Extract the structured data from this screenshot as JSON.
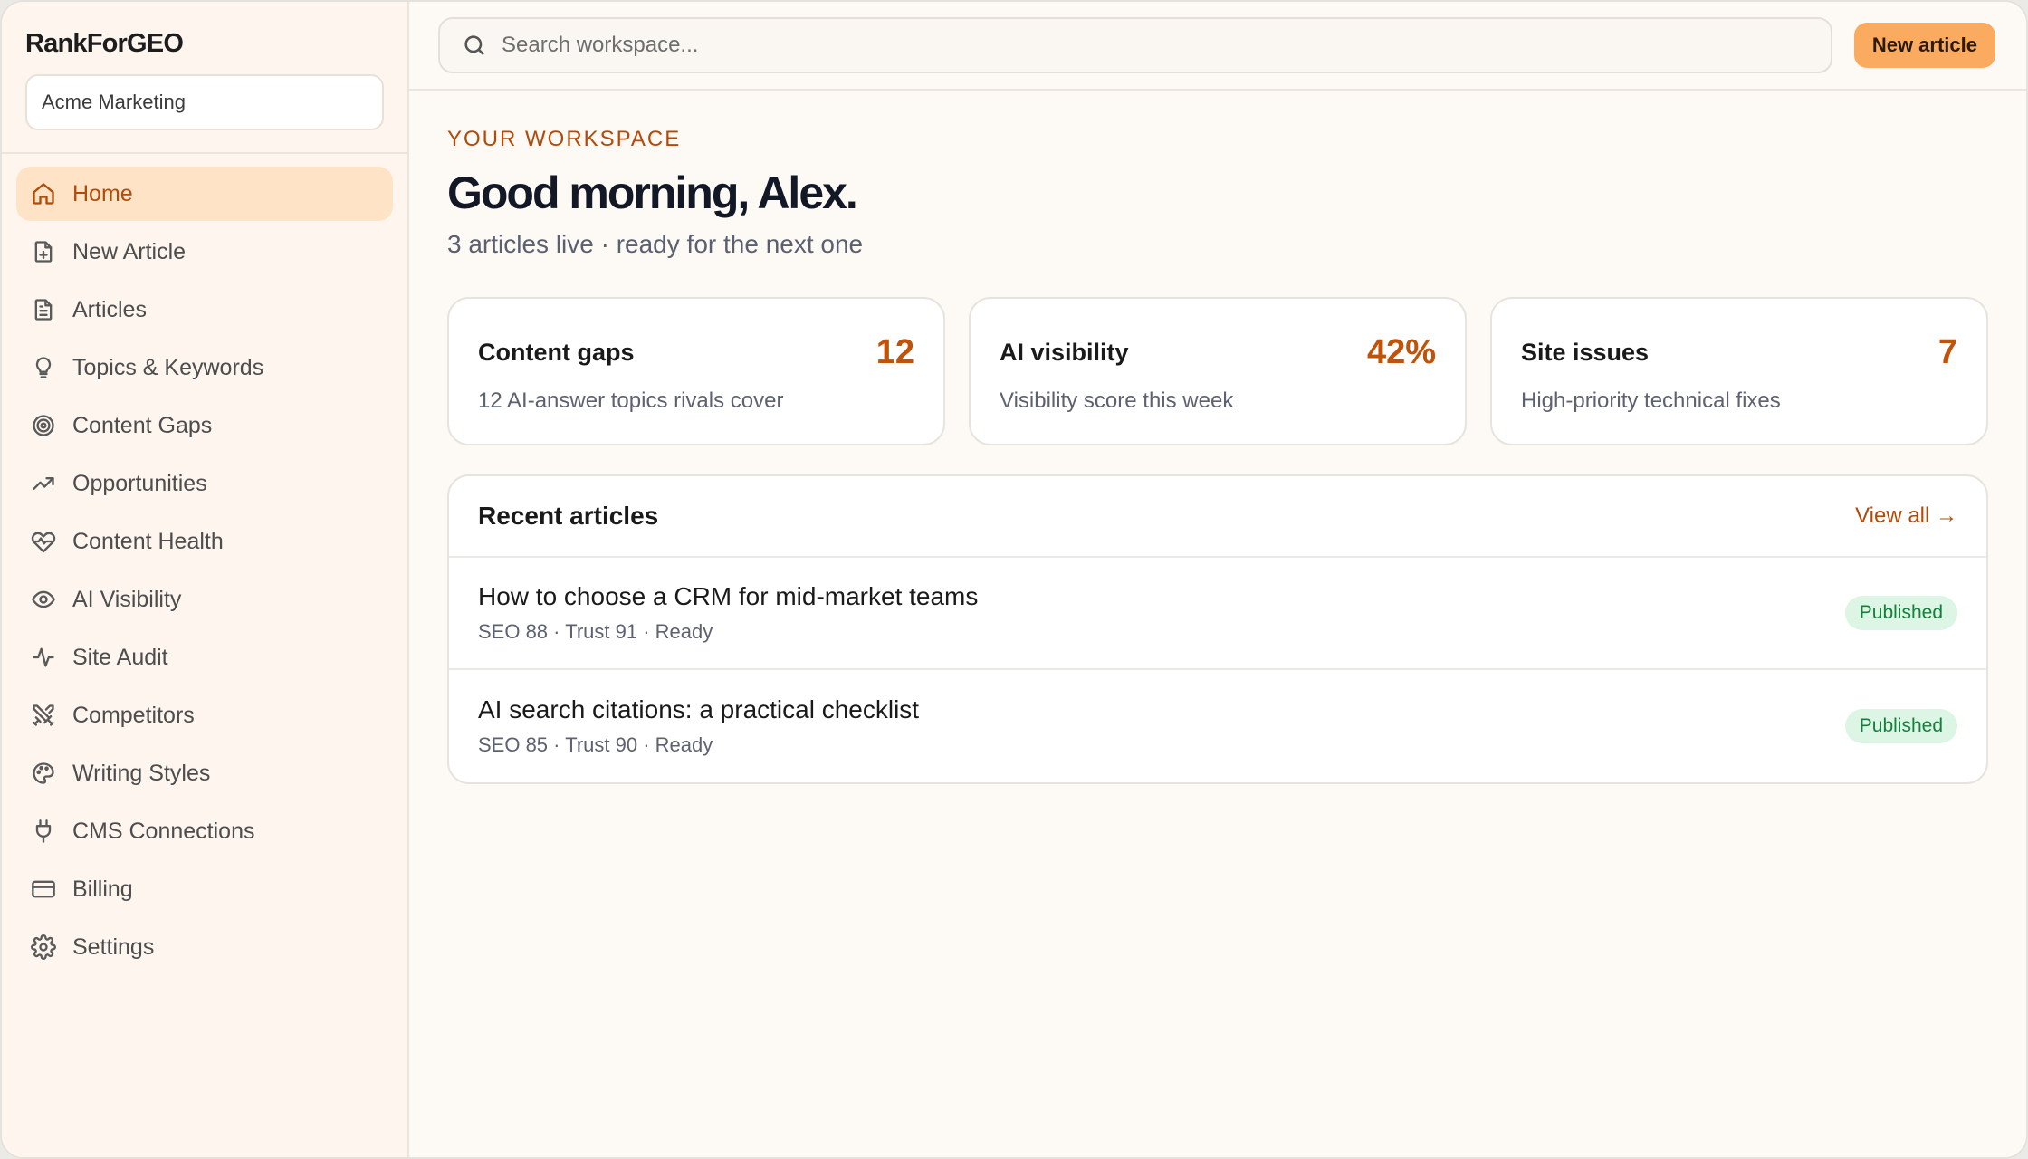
{
  "brand": "RankForGEO",
  "workspace": "Acme Marketing",
  "sidebar": {
    "items": [
      {
        "label": "Home",
        "icon": "home-icon",
        "active": true
      },
      {
        "label": "New Article",
        "icon": "file-plus-icon"
      },
      {
        "label": "Articles",
        "icon": "file-text-icon"
      },
      {
        "label": "Topics & Keywords",
        "icon": "lightbulb-icon"
      },
      {
        "label": "Content Gaps",
        "icon": "target-icon"
      },
      {
        "label": "Opportunities",
        "icon": "trending-up-icon"
      },
      {
        "label": "Content Health",
        "icon": "heart-pulse-icon"
      },
      {
        "label": "AI Visibility",
        "icon": "eye-icon"
      },
      {
        "label": "Site Audit",
        "icon": "activity-icon"
      },
      {
        "label": "Competitors",
        "icon": "swords-icon"
      },
      {
        "label": "Writing Styles",
        "icon": "palette-icon"
      },
      {
        "label": "CMS Connections",
        "icon": "plug-icon"
      },
      {
        "label": "Billing",
        "icon": "credit-card-icon"
      },
      {
        "label": "Settings",
        "icon": "gear-icon"
      }
    ]
  },
  "topbar": {
    "search_placeholder": "Search workspace...",
    "new_button": "New article"
  },
  "main": {
    "eyebrow": "YOUR WORKSPACE",
    "greeting": "Good morning, Alex.",
    "subline": "3 articles live · ready for the next one",
    "stats": [
      {
        "title": "Content gaps",
        "value": "12",
        "desc": "12 AI-answer topics rivals cover"
      },
      {
        "title": "AI visibility",
        "value": "42%",
        "desc": "Visibility score this week"
      },
      {
        "title": "Site issues",
        "value": "7",
        "desc": "High-priority technical fixes"
      }
    ],
    "recent": {
      "title": "Recent articles",
      "view_all": "View all →",
      "articles": [
        {
          "title": "How to choose a CRM for mid-market teams",
          "meta": "SEO 88 · Trust 91 · Ready",
          "status": "Published"
        },
        {
          "title": "AI search citations: a practical checklist",
          "meta": "SEO 85 · Trust 90 · Ready",
          "status": "Published"
        }
      ]
    }
  },
  "colors": {
    "accent": "#b24a09",
    "accent_bg": "#fee3c6",
    "button": "#fbab5f",
    "stat_value": "#c0530a",
    "badge_bg": "#dcf5e4",
    "badge_text": "#14803d"
  }
}
